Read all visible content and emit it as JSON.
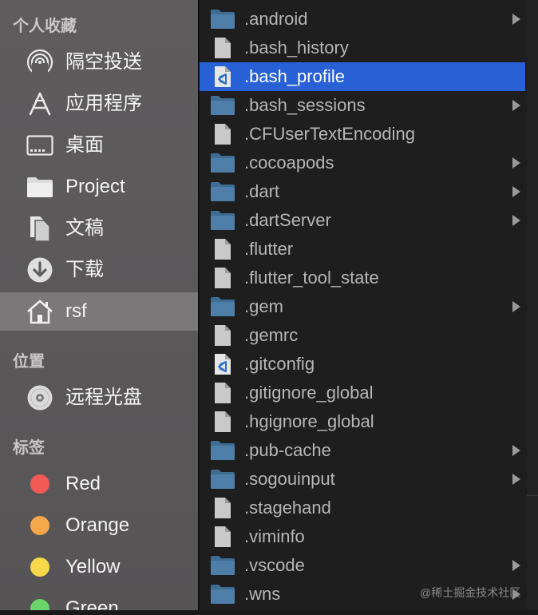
{
  "sidebar": {
    "favorites_heading": "个人收藏",
    "favorites": [
      {
        "label": "隔空投送",
        "icon": "airdrop-icon"
      },
      {
        "label": "应用程序",
        "icon": "applications-icon"
      },
      {
        "label": "桌面",
        "icon": "desktop-icon"
      },
      {
        "label": "Project",
        "icon": "folder-icon"
      },
      {
        "label": "文稿",
        "icon": "documents-icon"
      },
      {
        "label": "下载",
        "icon": "downloads-icon"
      },
      {
        "label": "rsf",
        "icon": "home-icon",
        "selected": true
      }
    ],
    "locations_heading": "位置",
    "locations": [
      {
        "label": "远程光盘",
        "icon": "remote-disc-icon"
      }
    ],
    "tags_heading": "标签",
    "tags": [
      {
        "label": "Red",
        "color": "#f25b55"
      },
      {
        "label": "Orange",
        "color": "#f5a84a"
      },
      {
        "label": "Yellow",
        "color": "#f6d84a"
      },
      {
        "label": "Green",
        "color": "#6ad56a"
      }
    ]
  },
  "files": [
    {
      "name": ".android",
      "type": "folder",
      "has_children": true
    },
    {
      "name": ".bash_history",
      "type": "file"
    },
    {
      "name": ".bash_profile",
      "type": "vscode",
      "selected": true
    },
    {
      "name": ".bash_sessions",
      "type": "folder",
      "has_children": true
    },
    {
      "name": ".CFUserTextEncoding",
      "type": "file"
    },
    {
      "name": ".cocoapods",
      "type": "folder",
      "has_children": true
    },
    {
      "name": ".dart",
      "type": "folder",
      "has_children": true
    },
    {
      "name": ".dartServer",
      "type": "folder",
      "has_children": true
    },
    {
      "name": ".flutter",
      "type": "file"
    },
    {
      "name": ".flutter_tool_state",
      "type": "file"
    },
    {
      "name": ".gem",
      "type": "folder",
      "has_children": true
    },
    {
      "name": ".gemrc",
      "type": "file"
    },
    {
      "name": ".gitconfig",
      "type": "vscode"
    },
    {
      "name": ".gitignore_global",
      "type": "file"
    },
    {
      "name": ".hgignore_global",
      "type": "file"
    },
    {
      "name": ".pub-cache",
      "type": "folder",
      "has_children": true
    },
    {
      "name": ".sogouinput",
      "type": "folder",
      "has_children": true
    },
    {
      "name": ".stagehand",
      "type": "file"
    },
    {
      "name": ".viminfo",
      "type": "file"
    },
    {
      "name": ".vscode",
      "type": "folder",
      "has_children": true
    },
    {
      "name": ".wns",
      "type": "folder",
      "has_children": true
    }
  ],
  "colors": {
    "selection": "#2860d6",
    "folder": "#4f7fa8",
    "file": "#c9c9c9"
  },
  "watermark": "@稀土掘金技术社区"
}
